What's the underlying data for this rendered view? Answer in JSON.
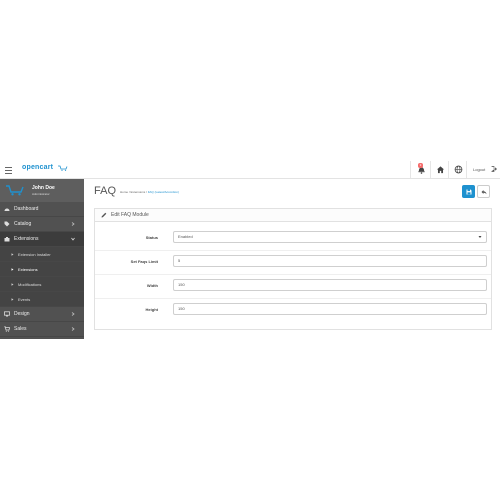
{
  "header": {
    "brand": "opencart",
    "notification_count": "3",
    "logout_label": "Logout",
    "icons": [
      "menu-icon",
      "cart-icon",
      "bell-icon",
      "home-icon",
      "globe-icon",
      "sign-out-icon"
    ]
  },
  "sidebar": {
    "profile": {
      "name": "John Doe",
      "role": "Administrator"
    },
    "items": [
      {
        "label": "Dashboard",
        "icon": "dashboard-icon"
      },
      {
        "label": "Catalog",
        "icon": "tag-icon"
      },
      {
        "label": "Extensions",
        "icon": "puzzle-icon"
      },
      {
        "label": "Extension Installer"
      },
      {
        "label": "Extensions"
      },
      {
        "label": "Modifications"
      },
      {
        "label": "Events"
      },
      {
        "label": "Design",
        "icon": "desktop-icon"
      },
      {
        "label": "Sales",
        "icon": "shopping-cart-icon"
      }
    ]
  },
  "content": {
    "title": "FAQ",
    "breadcrumb": {
      "home": "Home",
      "sep": " / ",
      "extensions": "Extensions",
      "current": "FAQ (Latest/Accordion)"
    },
    "panel_title": "Edit FAQ Module",
    "form": {
      "status_label": "Status",
      "status_value": "Enabled",
      "limit_label": "Set Faqs Limit",
      "limit_value": "5",
      "width_label": "Width",
      "width_value": "150",
      "height_label": "Height",
      "height_value": "150"
    }
  },
  "colors": {
    "accent": "#1e91cf",
    "sidebar": "#515151",
    "badge": "#f56b6b"
  }
}
